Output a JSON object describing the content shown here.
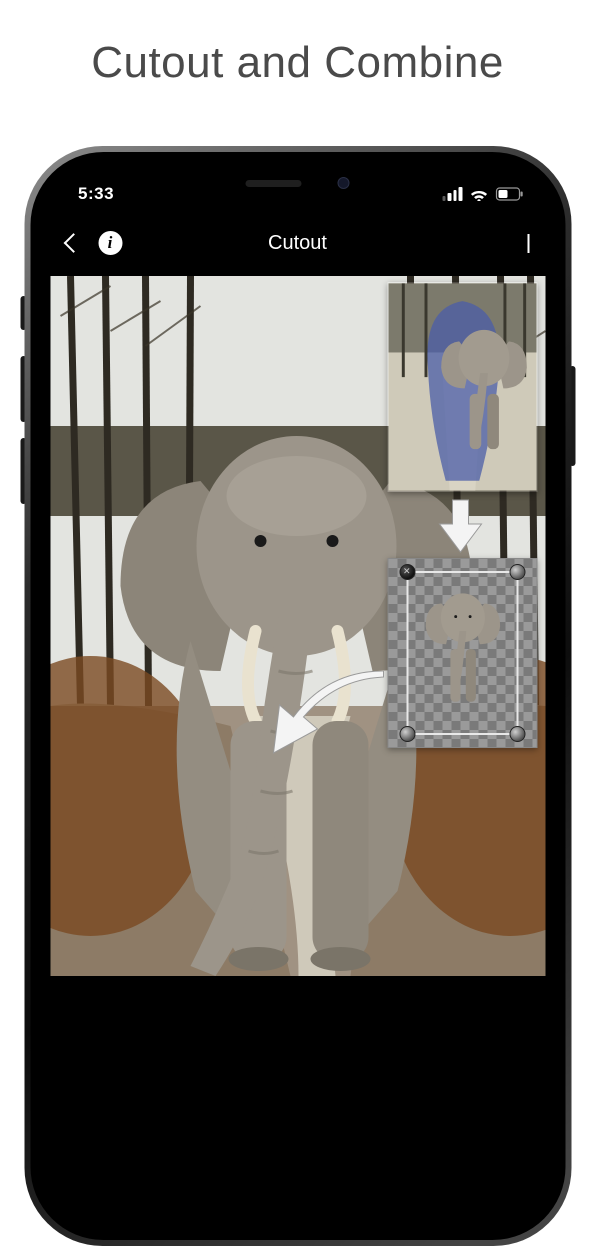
{
  "promo": {
    "headline": "Cutout and Combine"
  },
  "status_bar": {
    "time": "5:33"
  },
  "nav": {
    "title": "Cutout",
    "info_glyph": "i"
  },
  "colors": {
    "selection_overlay": "#4b5ea8",
    "canvas_bg": "#000000",
    "checker_light": "#9a9a9a",
    "checker_dark": "#7a7a7a"
  }
}
